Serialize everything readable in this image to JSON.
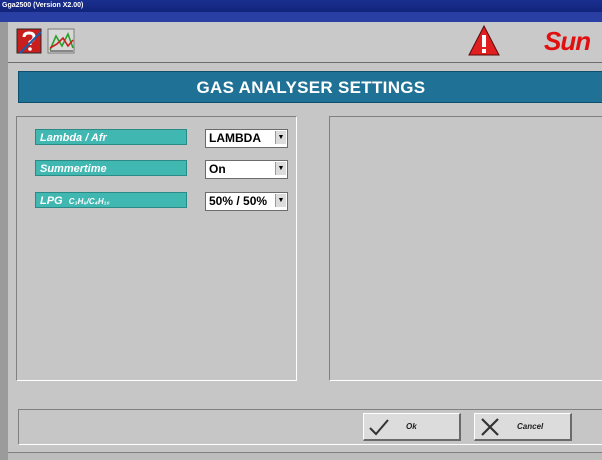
{
  "window": {
    "title": "Gga2500 (Version X2.00)"
  },
  "toolbar": {
    "brand_text": "Sun",
    "icons": [
      "help-icon",
      "graph-icon",
      "warning-icon"
    ]
  },
  "header": {
    "title": "GAS ANALYSER SETTINGS"
  },
  "settings": [
    {
      "label": "Lambda / Afr",
      "value": "LAMBDA"
    },
    {
      "label": "Summertime",
      "value": "On"
    },
    {
      "label_main": "LPG",
      "label_formula": "C₃H₈/C₄H₁₀",
      "value": "50% / 50%"
    }
  ],
  "buttons": {
    "ok": "Ok",
    "cancel": "Cancel"
  },
  "colors": {
    "header_bg": "#1f7196",
    "label_bg": "#41b7b2",
    "brand": "#e01010",
    "titlebar": "#1a2f8f"
  }
}
